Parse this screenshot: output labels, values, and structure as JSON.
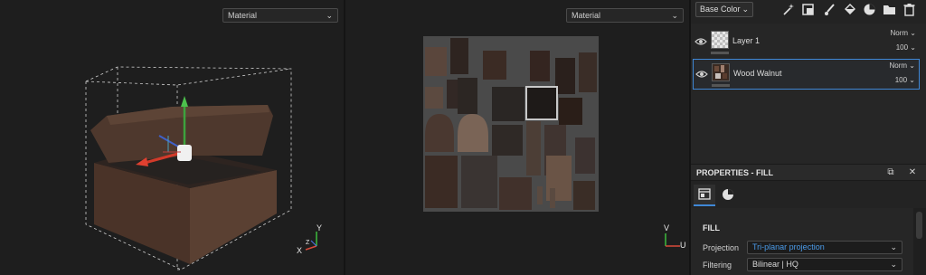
{
  "viewport_3d": {
    "material_select": "Material",
    "axes": {
      "y": "Y",
      "x": "X",
      "z": "Z"
    }
  },
  "viewport_2d": {
    "material_select": "Material",
    "axes": {
      "v": "V",
      "u": "U"
    }
  },
  "toolbar": {
    "channel_select": "Base Color",
    "icons": [
      "magic-wand-icon",
      "add-mask-icon",
      "paint-brush-icon",
      "fill-bucket-icon",
      "material-icon",
      "folder-icon",
      "trash-icon"
    ]
  },
  "layers": [
    {
      "name": "Layer 1",
      "blend": "Norm",
      "opacity": "100",
      "selected": false
    },
    {
      "name": "Wood Walnut",
      "blend": "Norm",
      "opacity": "100",
      "selected": true
    }
  ],
  "properties": {
    "title": "PROPERTIES - FILL",
    "section": "FILL",
    "fields": [
      {
        "label": "Projection",
        "value": "Tri-planar projection"
      },
      {
        "label": "Filtering",
        "value": "Bilinear | HQ"
      }
    ]
  },
  "colors": {
    "accent": "#3f87d6",
    "link_value": "#4a9ae8"
  }
}
